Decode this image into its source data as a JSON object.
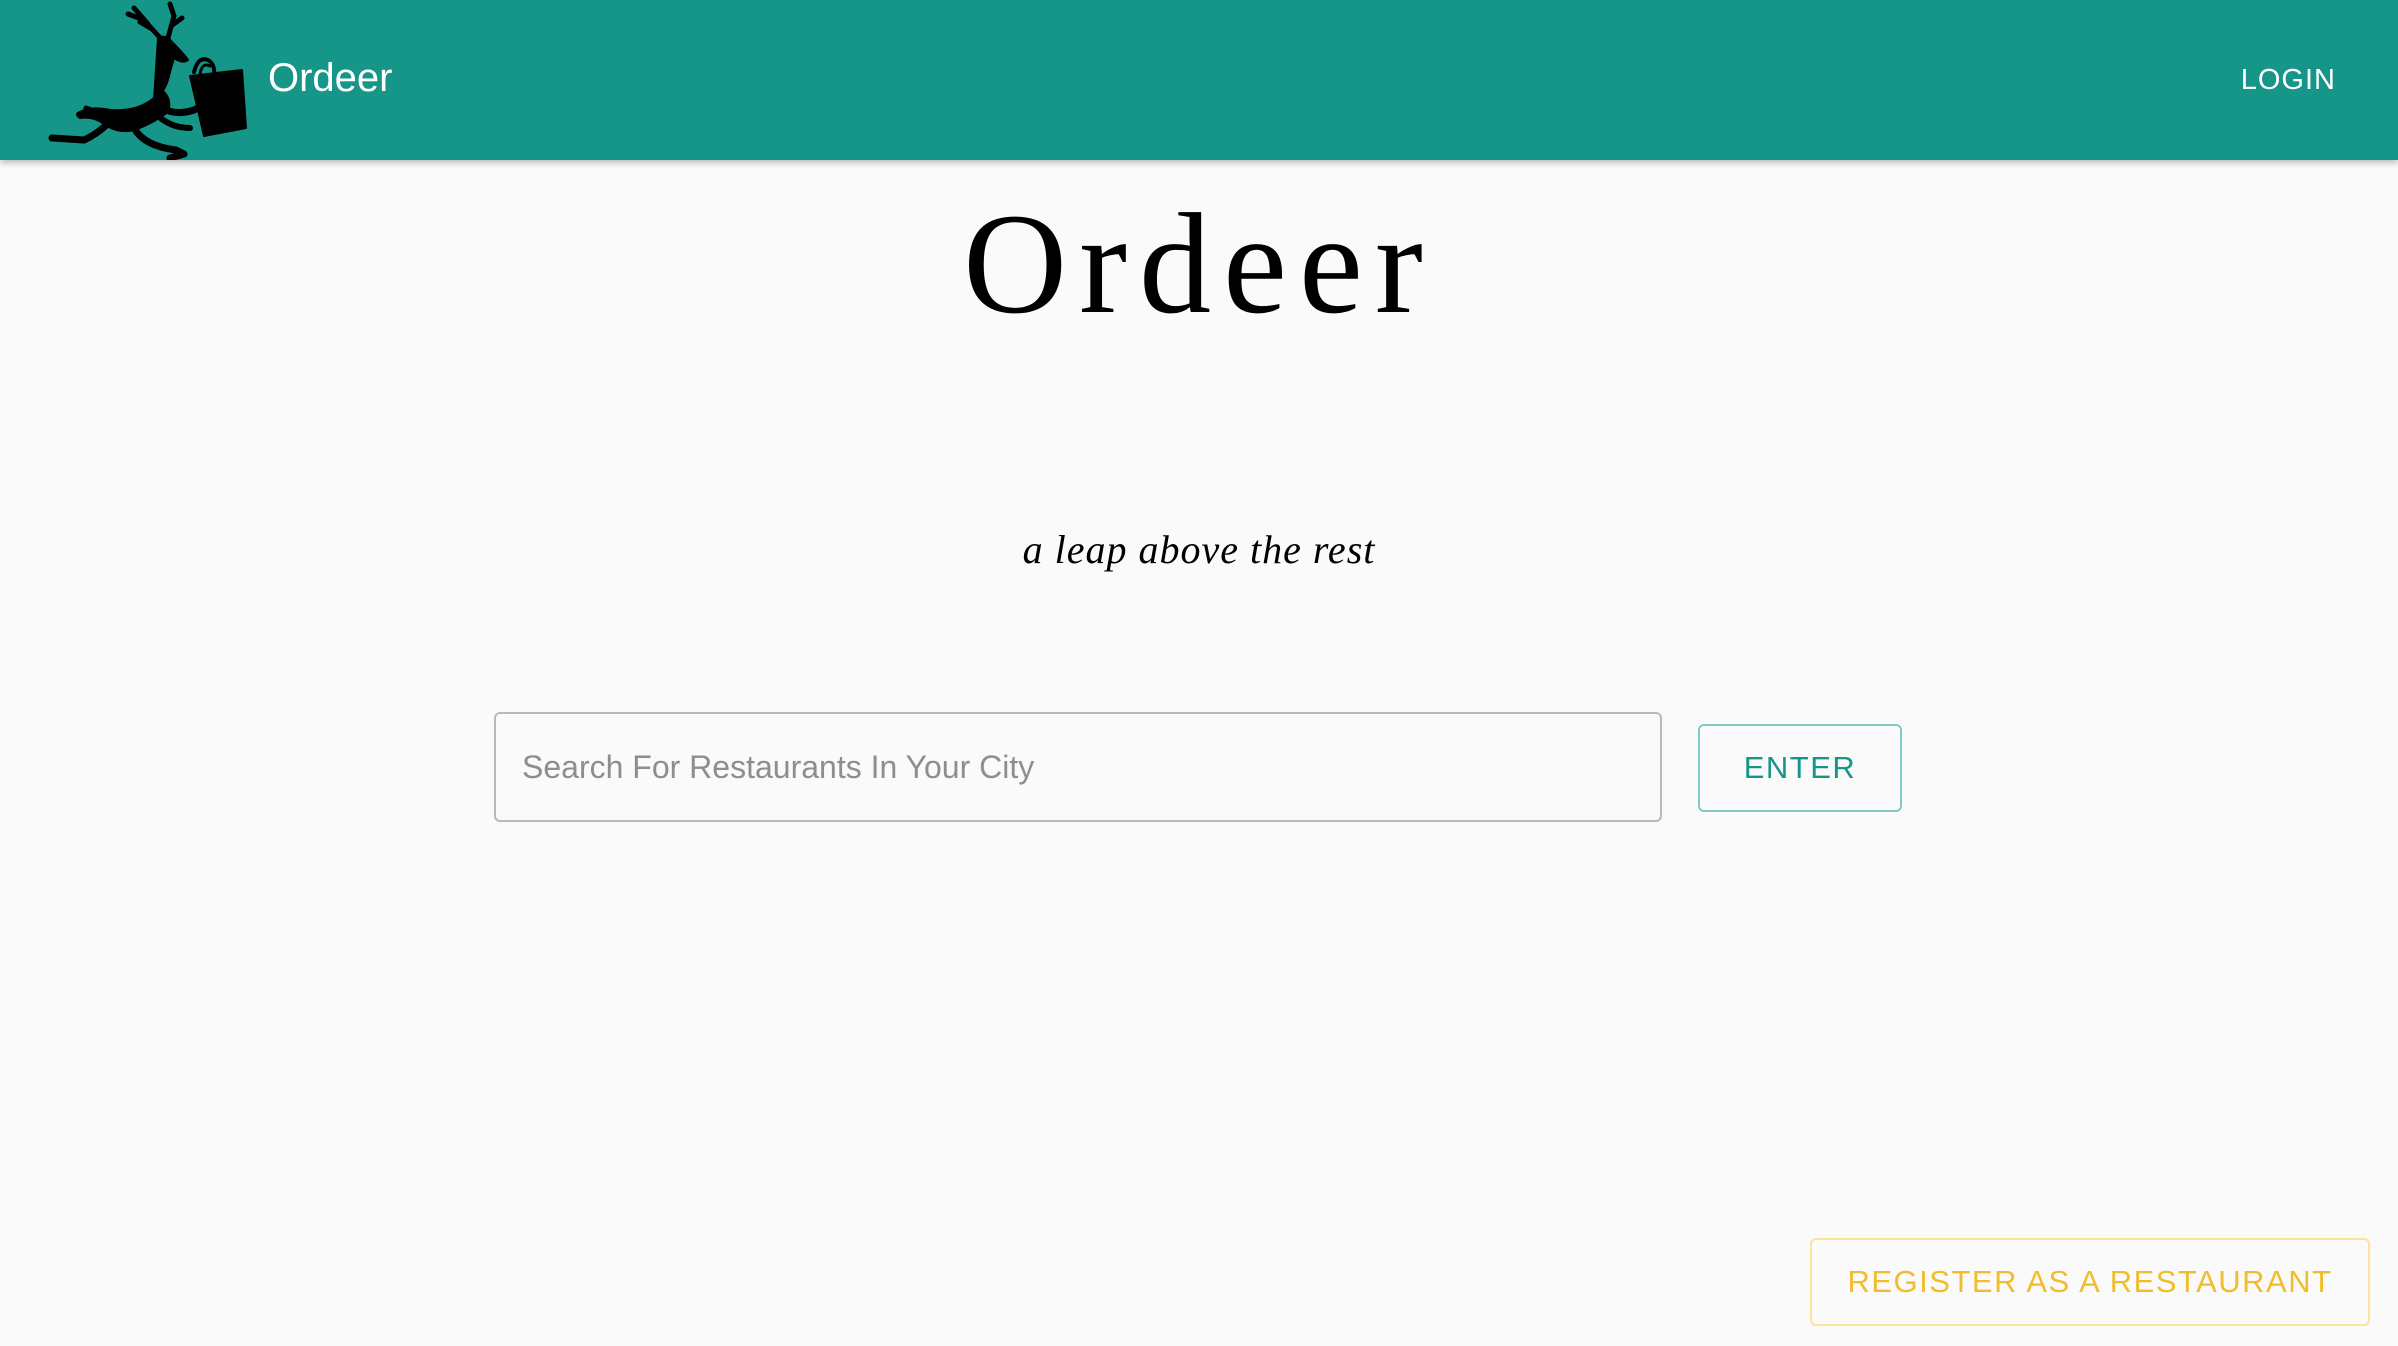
{
  "header": {
    "logo_icon": "deer-with-shopping-bag-icon",
    "brand": "Ordeer",
    "login_label": "LOGIN",
    "background_color": "#169689"
  },
  "hero": {
    "title": "Ordeer",
    "tagline": "a leap above the rest"
  },
  "search": {
    "placeholder": "Search For Restaurants In Your City",
    "value": "",
    "enter_label": "ENTER"
  },
  "register": {
    "label": "REGISTER AS A RESTAURANT",
    "color": "#f2bd2c"
  }
}
